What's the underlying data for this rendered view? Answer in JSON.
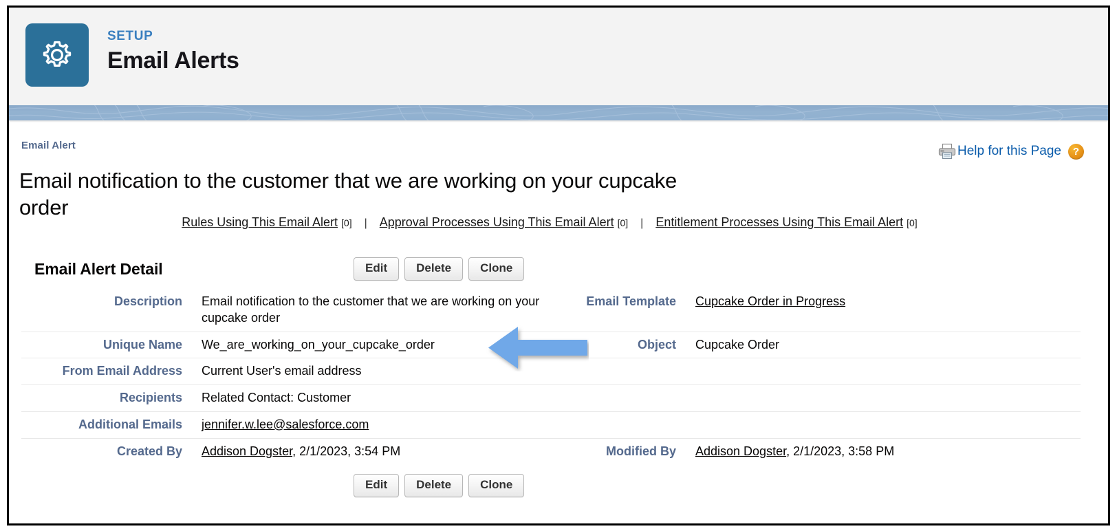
{
  "setup_header": {
    "eyebrow": "SETUP",
    "title": "Email Alerts",
    "icon": "gear-icon",
    "tile_color": "#2b7099",
    "eyebrow_color": "#3a7fbf"
  },
  "record": {
    "eyebrow": "Email Alert",
    "title": "Email notification to the customer that we are working on your cupcake order"
  },
  "help": {
    "printer_icon": "printer-icon",
    "link_label": "Help for this Page",
    "badge_label": "?",
    "link_color": "#0b5cab",
    "badge_color": "#e8941a"
  },
  "related_links": [
    {
      "label": "Rules Using This Email Alert",
      "count": "[0]"
    },
    {
      "label": "Approval Processes Using This Email Alert",
      "count": "[0]"
    },
    {
      "label": "Entitlement Processes Using This Email Alert",
      "count": "[0]"
    }
  ],
  "separator": "|",
  "detail": {
    "heading": "Email Alert Detail",
    "buttons": {
      "edit": "Edit",
      "delete": "Delete",
      "clone": "Clone"
    },
    "rows": [
      {
        "left_label": "Description",
        "left_value": "Email notification to the customer that we are working on your cupcake order",
        "left_is_link": false,
        "right_label": "Email Template",
        "right_value": "Cupcake Order in Progress",
        "right_is_link": true
      },
      {
        "left_label": "Unique Name",
        "left_value": "We_are_working_on_your_cupcake_order",
        "left_is_link": false,
        "right_label": "Object",
        "right_value": "Cupcake Order",
        "right_is_link": false
      },
      {
        "left_label": "From Email Address",
        "left_value": "Current User's email address",
        "left_is_link": false,
        "right_label": "",
        "right_value": "",
        "right_is_link": false
      },
      {
        "left_label": "Recipients",
        "left_value": "Related Contact: Customer",
        "left_is_link": false,
        "right_label": "",
        "right_value": "",
        "right_is_link": false
      },
      {
        "left_label": "Additional Emails",
        "left_value": "jennifer.w.lee@salesforce.com",
        "left_is_link": true,
        "right_label": "",
        "right_value": "",
        "right_is_link": false
      }
    ],
    "audit": {
      "created_label": "Created By",
      "created_user": "Addison Dogster",
      "created_meta": ", 2/1/2023, 3:54 PM",
      "modified_label": "Modified By",
      "modified_user": "Addison Dogster",
      "modified_meta": ", 2/1/2023, 3:58 PM"
    }
  },
  "annotation": {
    "shape": "left-arrow",
    "color": "#6fa8e8",
    "points_at": "Unique Name value"
  }
}
